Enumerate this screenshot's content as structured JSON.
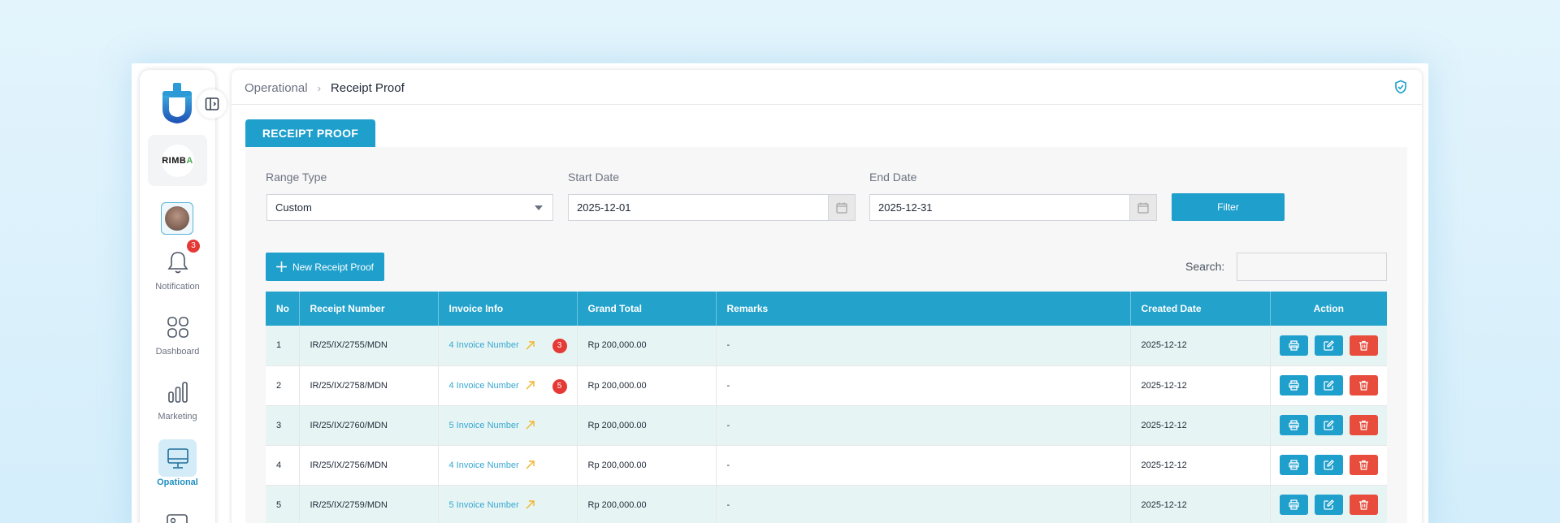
{
  "sidebar": {
    "company_logo_text": "RIMB",
    "company_logo_accent": "A",
    "notification_count": "3",
    "items": [
      {
        "label": "Notification",
        "icon": "bell-icon"
      },
      {
        "label": "Dashboard",
        "icon": "grid-icon"
      },
      {
        "label": "Marketing",
        "icon": "bar-chart-icon"
      },
      {
        "label": "Opational",
        "icon": "monitor-icon",
        "active": true
      }
    ]
  },
  "breadcrumb": {
    "parent": "Operational",
    "separator": "›",
    "current": "Receipt Proof"
  },
  "tab": {
    "label": "RECEIPT PROOF"
  },
  "filters": {
    "range_type_label": "Range Type",
    "range_type_value": "Custom",
    "start_date_label": "Start Date",
    "start_date_value": "2025-12-01",
    "end_date_label": "End Date",
    "end_date_value": "2025-12-31",
    "filter_button": "Filter"
  },
  "toolbar": {
    "new_button": "New Receipt Proof",
    "search_label": "Search:",
    "search_value": ""
  },
  "table": {
    "columns": [
      "No",
      "Receipt Number",
      "Invoice Info",
      "Grand Total",
      "Remarks",
      "Created Date",
      "Action"
    ],
    "rows": [
      {
        "no": "1",
        "receipt": "IR/25/IX/2755/MDN",
        "invoice": "4 Invoice Number",
        "badge": "3",
        "total": "Rp 200,000.00",
        "remarks": "-",
        "created": "2025-12-12"
      },
      {
        "no": "2",
        "receipt": "IR/25/IX/2758/MDN",
        "invoice": "4 Invoice Number",
        "badge": "5",
        "total": "Rp 200,000.00",
        "remarks": "-",
        "created": "2025-12-12"
      },
      {
        "no": "3",
        "receipt": "IR/25/IX/2760/MDN",
        "invoice": "5 Invoice Number",
        "badge": "",
        "total": "Rp 200,000.00",
        "remarks": "-",
        "created": "2025-12-12"
      },
      {
        "no": "4",
        "receipt": "IR/25/IX/2756/MDN",
        "invoice": "4 Invoice Number",
        "badge": "",
        "total": "Rp 200,000.00",
        "remarks": "-",
        "created": "2025-12-12"
      },
      {
        "no": "5",
        "receipt": "IR/25/IX/2759/MDN",
        "invoice": "5 Invoice Number",
        "badge": "",
        "total": "Rp 200,000.00",
        "remarks": "-",
        "created": "2025-12-12"
      }
    ]
  },
  "colors": {
    "primary": "#1e9fcc",
    "danger": "#e74c3c",
    "row_alt": "#e6f5f4",
    "link": "#37a7d1",
    "external_arrow": "#f0b429"
  }
}
